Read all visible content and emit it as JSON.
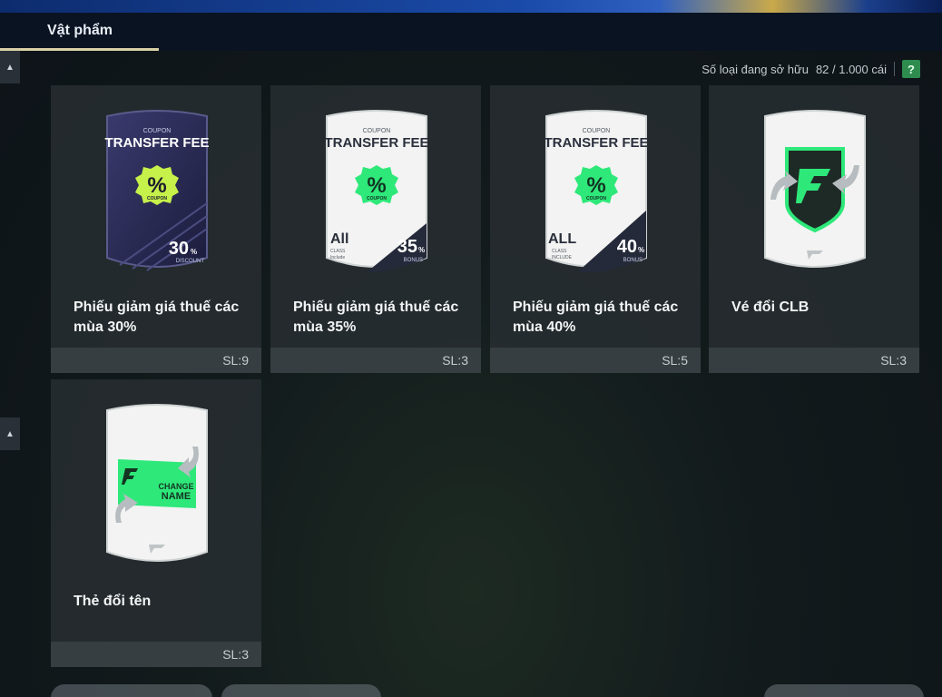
{
  "tabs": [
    {
      "label": "Vật phẩm",
      "active": true
    }
  ],
  "owned": {
    "label": "Số loại đang sở hữu",
    "value": "82 / 1.000 cái",
    "help": "?"
  },
  "items": [
    {
      "name": "Phiếu giảm giá thuế các mùa 30%",
      "qty": "SL:9",
      "icon": "transfer-fee-coupon-30-icon",
      "art": {
        "coupon": "COUPON",
        "title": "TRANSFER FEE",
        "percent": "30",
        "pct_sign": "%",
        "caption": "DISCOUNT",
        "badge": "COUPON"
      }
    },
    {
      "name": "Phiếu giảm giá thuế các mùa 35%",
      "qty": "SL:3",
      "icon": "transfer-fee-coupon-35-icon",
      "art": {
        "coupon": "COUPON",
        "title": "TRANSFER FEE",
        "all": "All",
        "class": "CLASS",
        "include": "Include",
        "percent": "35",
        "pct_sign": "%",
        "caption": "BONUS",
        "badge": "COUPON"
      }
    },
    {
      "name": "Phiếu giảm giá thuế các mùa 40%",
      "qty": "SL:5",
      "icon": "transfer-fee-coupon-40-icon",
      "art": {
        "coupon": "COUPON",
        "title": "TRANSFER FEE",
        "all": "ALL",
        "class": "CLASS",
        "include": "INCLUDE",
        "percent": "40",
        "pct_sign": "%",
        "caption": "BONUS",
        "badge": "COUPON"
      }
    },
    {
      "name": "Vé đổi CLB",
      "qty": "SL:3",
      "icon": "club-change-ticket-icon",
      "art": {}
    },
    {
      "name": "Thẻ đổi tên",
      "qty": "SL:3",
      "icon": "name-change-card-icon",
      "art": {
        "change": "CHANGE",
        "name": "NAME"
      }
    }
  ],
  "colors": {
    "accent_green": "#2ee87a",
    "tab_underline": "#d8d0a6",
    "help_bg": "#2e8c4e",
    "card_dark": "#2a2d52"
  }
}
